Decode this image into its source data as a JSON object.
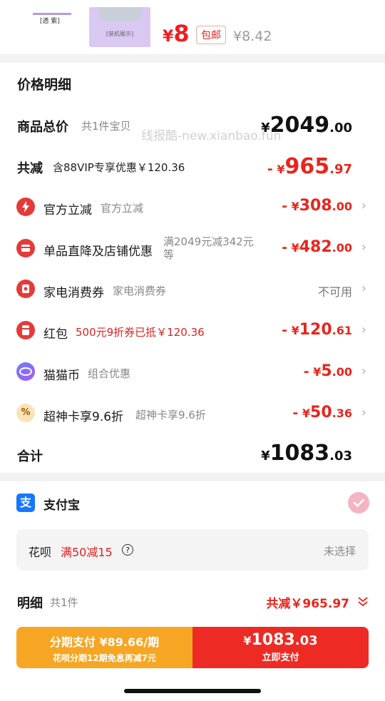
{
  "product": {
    "thumb1_label": "[透 紫]",
    "thumb2_label": "[装机展示]",
    "price_symbol": "¥",
    "price": "8",
    "shipping_badge": "包邮",
    "original_price": "¥8.42"
  },
  "details": {
    "title": "价格明细",
    "total": {
      "label": "商品总价",
      "sub": "共1件宝贝",
      "symbol": "¥",
      "int": "2049",
      "dec": ".00"
    },
    "watermark": "线报酷-new.xianbao.fun",
    "reduce": {
      "label": "共减",
      "sub": "含88VIP专享优惠￥120.36",
      "sign": "-",
      "symbol": "¥",
      "int": "965",
      "dec": ".97"
    },
    "rows": [
      {
        "label": "官方立减",
        "sub": "官方立减",
        "sign": "-",
        "symbol": "¥",
        "int": "308",
        "dec": ".00",
        "icon": "lightning-icon"
      },
      {
        "label": "单品直降及店铺优惠",
        "sub_line1": "满2049元减342元",
        "sub_line2": "等",
        "sign": "-",
        "symbol": "¥",
        "int": "482",
        "dec": ".00",
        "icon": "shop-icon"
      },
      {
        "label": "家电消费券",
        "sub": "家电消费券",
        "status": "不可用",
        "icon": "coupon-icon"
      },
      {
        "label": "红包",
        "sub": "500元9折券已抵￥120.36",
        "sign": "-",
        "symbol": "¥",
        "int": "120",
        "dec": ".61",
        "icon": "red-packet-icon"
      },
      {
        "label": "猫猫币",
        "sub": "组合优惠",
        "sign": "-",
        "symbol": "¥",
        "int": "5",
        "dec": ".00",
        "icon": "cat-coin-icon"
      },
      {
        "label": "超神卡享9.6折",
        "sub": "超神卡享9.6折",
        "sign": "-",
        "symbol": "¥",
        "int": "50",
        "dec": ".36",
        "icon": "percent-icon",
        "icon_text": "%"
      }
    ],
    "sum": {
      "label": "合计",
      "symbol": "¥",
      "int": "1083",
      "dec": ".03"
    }
  },
  "payment": {
    "method": "支付宝",
    "method_icon_text": "支",
    "huabei_label": "花呗",
    "huabei_promo": "满50减15",
    "huabei_help": "?",
    "huabei_status": "未选择"
  },
  "breakdown": {
    "label": "明细",
    "count": "共1件",
    "total_reduce": "共减￥965.97"
  },
  "actions": {
    "installment_main": "分期支付 ¥89.66/期",
    "installment_sub": "花呗分期12期免息再减7元",
    "pay_symbol": "¥",
    "pay_int": "1083",
    "pay_dec": ".03",
    "pay_sub": "立即支付"
  },
  "colors": {
    "accent_red": "#e8251d",
    "installment_orange": "#f6a623",
    "pay_red": "#ee2a24",
    "alipay_blue": "#1677ff"
  }
}
